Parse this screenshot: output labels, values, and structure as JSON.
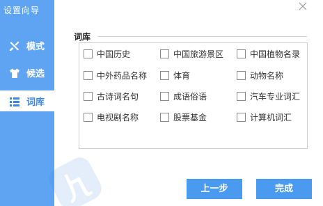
{
  "app": {
    "title": "设置向导"
  },
  "sidebar": {
    "items": [
      {
        "label": "模式",
        "icon": "tools-icon"
      },
      {
        "label": "候选",
        "icon": "shirt-icon"
      },
      {
        "label": "词库",
        "icon": "list-icon"
      }
    ],
    "active": "词库"
  },
  "lexicon": {
    "title": "词库",
    "options": [
      {
        "label": "中国历史",
        "checked": false
      },
      {
        "label": "中国旅游景区",
        "checked": false
      },
      {
        "label": "中国植物名录",
        "checked": false
      },
      {
        "label": "中外药品名称",
        "checked": false
      },
      {
        "label": "体育",
        "checked": false
      },
      {
        "label": "动物名称",
        "checked": false
      },
      {
        "label": "古诗词名句",
        "checked": false
      },
      {
        "label": "成语俗语",
        "checked": false
      },
      {
        "label": "汽车专业词汇",
        "checked": false
      },
      {
        "label": "电视剧名称",
        "checked": false
      },
      {
        "label": "股票基金",
        "checked": false
      },
      {
        "label": "计算机词汇",
        "checked": false
      }
    ]
  },
  "buttons": {
    "prev": "上一步",
    "finish": "完成"
  },
  "colors": {
    "sidebar": "#5fa4f2",
    "button": "#4a9bf0",
    "active_text": "#3a86e0"
  }
}
